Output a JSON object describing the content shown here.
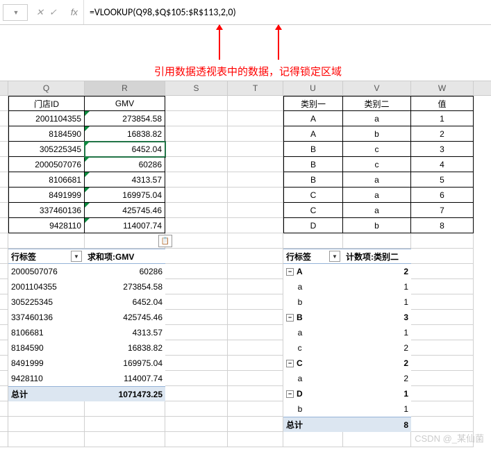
{
  "formula_bar": {
    "fx_label": "fx",
    "formula": "=VLOOKUP(Q98,$Q$105:$R$113,2,0)"
  },
  "annotation": {
    "text": "引用数据透视表中的数据，记得锁定区域"
  },
  "col_headers": {
    "Q": "Q",
    "R": "R",
    "S": "S",
    "T": "T",
    "U": "U",
    "V": "V",
    "W": "W"
  },
  "left_table": {
    "headers": {
      "Q": "门店ID",
      "R": "GMV"
    },
    "rows": [
      {
        "id": "2001104355",
        "gmv": "273854.58"
      },
      {
        "id": "8184590",
        "gmv": "16838.82"
      },
      {
        "id": "305225345",
        "gmv": "6452.04"
      },
      {
        "id": "2000507076",
        "gmv": "60286"
      },
      {
        "id": "8106681",
        "gmv": "4313.57"
      },
      {
        "id": "8491999",
        "gmv": "169975.04"
      },
      {
        "id": "337460136",
        "gmv": "425745.46"
      },
      {
        "id": "9428110",
        "gmv": "114007.74"
      }
    ]
  },
  "right_table": {
    "headers": {
      "U": "类别一",
      "V": "类别二",
      "W": "值"
    },
    "rows": [
      {
        "u": "A",
        "v": "a",
        "w": "1"
      },
      {
        "u": "A",
        "v": "b",
        "w": "2"
      },
      {
        "u": "B",
        "v": "c",
        "w": "3"
      },
      {
        "u": "B",
        "v": "c",
        "w": "4"
      },
      {
        "u": "B",
        "v": "a",
        "w": "5"
      },
      {
        "u": "C",
        "v": "a",
        "w": "6"
      },
      {
        "u": "C",
        "v": "a",
        "w": "7"
      },
      {
        "u": "D",
        "v": "b",
        "w": "8"
      }
    ]
  },
  "left_pivot": {
    "row_label_hdr": "行标签",
    "value_hdr": "求和项:GMV",
    "rows": [
      {
        "label": "2000507076",
        "val": "60286"
      },
      {
        "label": "2001104355",
        "val": "273854.58"
      },
      {
        "label": "305225345",
        "val": "6452.04"
      },
      {
        "label": "337460136",
        "val": "425745.46"
      },
      {
        "label": "8106681",
        "val": "4313.57"
      },
      {
        "label": "8184590",
        "val": "16838.82"
      },
      {
        "label": "8491999",
        "val": "169975.04"
      },
      {
        "label": "9428110",
        "val": "114007.74"
      }
    ],
    "total_label": "总计",
    "total_value": "1071473.25"
  },
  "right_pivot": {
    "row_label_hdr": "行标签",
    "value_hdr": "计数项:类别二",
    "items": [
      {
        "group": "A",
        "gval": "2",
        "children": [
          {
            "lab": "a",
            "v": "1"
          },
          {
            "lab": "b",
            "v": "1"
          }
        ]
      },
      {
        "group": "B",
        "gval": "3",
        "children": [
          {
            "lab": "a",
            "v": "1"
          },
          {
            "lab": "c",
            "v": "2"
          }
        ]
      },
      {
        "group": "C",
        "gval": "2",
        "children": [
          {
            "lab": "a",
            "v": "2"
          }
        ]
      },
      {
        "group": "D",
        "gval": "1",
        "children": [
          {
            "lab": "b",
            "v": "1"
          }
        ]
      }
    ],
    "total_label": "总计",
    "total_value": "8"
  },
  "watermark": "CSDN @_某仙菌",
  "chart_data": {
    "type": "table",
    "tables": [
      {
        "name": "left_data",
        "columns": [
          "门店ID",
          "GMV"
        ],
        "rows": [
          [
            "2001104355",
            273854.58
          ],
          [
            "8184590",
            16838.82
          ],
          [
            "305225345",
            6452.04
          ],
          [
            "2000507076",
            60286
          ],
          [
            "8106681",
            4313.57
          ],
          [
            "8491999",
            169975.04
          ],
          [
            "337460136",
            425745.46
          ],
          [
            "9428110",
            114007.74
          ]
        ]
      },
      {
        "name": "right_data",
        "columns": [
          "类别一",
          "类别二",
          "值"
        ],
        "rows": [
          [
            "A",
            "a",
            1
          ],
          [
            "A",
            "b",
            2
          ],
          [
            "B",
            "c",
            3
          ],
          [
            "B",
            "c",
            4
          ],
          [
            "B",
            "a",
            5
          ],
          [
            "C",
            "a",
            6
          ],
          [
            "C",
            "a",
            7
          ],
          [
            "D",
            "b",
            8
          ]
        ]
      },
      {
        "name": "left_pivot",
        "columns": [
          "行标签",
          "求和项:GMV"
        ],
        "rows": [
          [
            "2000507076",
            60286
          ],
          [
            "2001104355",
            273854.58
          ],
          [
            "305225345",
            6452.04
          ],
          [
            "337460136",
            425745.46
          ],
          [
            "8106681",
            4313.57
          ],
          [
            "8184590",
            16838.82
          ],
          [
            "8491999",
            169975.04
          ],
          [
            "9428110",
            114007.74
          ],
          [
            "总计",
            1071473.25
          ]
        ]
      },
      {
        "name": "right_pivot",
        "columns": [
          "行标签",
          "计数项:类别二"
        ],
        "rows": [
          [
            "A",
            2
          ],
          [
            "a",
            1
          ],
          [
            "b",
            1
          ],
          [
            "B",
            3
          ],
          [
            "a",
            1
          ],
          [
            "c",
            2
          ],
          [
            "C",
            2
          ],
          [
            "a",
            2
          ],
          [
            "D",
            1
          ],
          [
            "b",
            1
          ],
          [
            "总计",
            8
          ]
        ]
      }
    ]
  }
}
